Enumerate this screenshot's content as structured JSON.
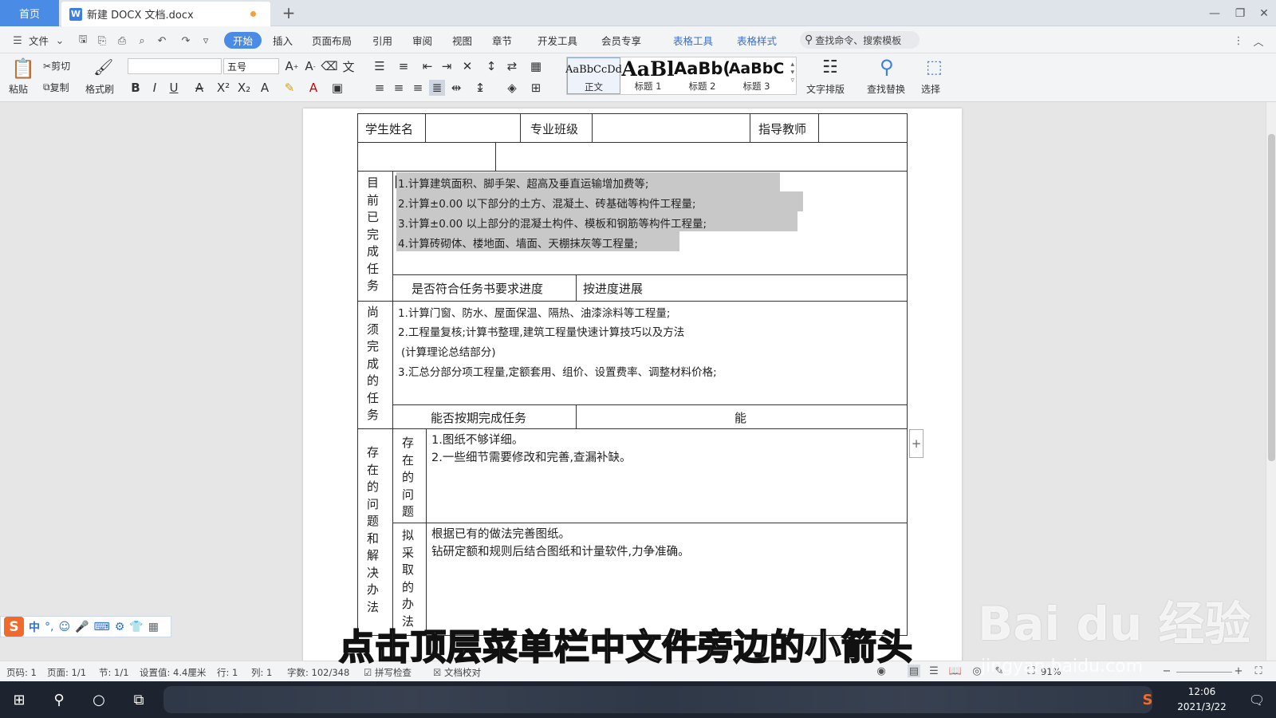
{
  "tabs": {
    "home": "首页",
    "doc_title": "新建 DOCX 文档.docx",
    "add": "+"
  },
  "menu": {
    "file": "文件",
    "items": [
      "开始",
      "插入",
      "页面布局",
      "引用",
      "审阅",
      "视图",
      "章节",
      "开发工具",
      "会员专享",
      "表格工具",
      "表格样式"
    ],
    "search_placeholder": "查找命令、搜索模板"
  },
  "ribbon": {
    "paste": "粘贴",
    "cut": "剪切",
    "copy": "复制",
    "format_painter": "格式刷",
    "font_name": "",
    "font_size": "五号",
    "styles": [
      {
        "preview": "AaBbCcDd",
        "name": "正文"
      },
      {
        "preview": "AaBl",
        "name": "标题 1"
      },
      {
        "preview": "AaBb(",
        "name": "标题 2"
      },
      {
        "preview": "AaBbC",
        "name": "标题 3"
      }
    ],
    "text_layout": "文字排版",
    "find_replace": "查找替换",
    "select": "选择"
  },
  "document": {
    "row1": {
      "student_name": "学生姓名",
      "major_class": "专业班级",
      "advisor": "指导教师"
    },
    "completed": {
      "label": [
        "目",
        "前",
        "已",
        "完",
        "成",
        "任",
        "务"
      ],
      "items": [
        "1.计算建筑面积、脚手架、超高及垂直运输增加费等;",
        "2.计算±0.00 以下部分的土方、混凝土、砖基础等构件工程量;",
        "3.计算±0.00 以上部分的混凝土构件、模板和钢筋等构件工程量;",
        "4.计算砖砌体、楼地面、墙面、天棚抹灰等工程量;"
      ],
      "progress_q": "是否符合任务书要求进度",
      "progress_a": "按进度进展"
    },
    "remaining": {
      "label": [
        "尚",
        "须",
        "完",
        "成",
        "的",
        "任",
        "务"
      ],
      "items": [
        "1.计算门窗、防水、屋面保温、隔热、油漆涂料等工程量;",
        "2.工程量复核;计算书整理,建筑工程量快速计算技巧以及方法",
        "(计算理论总结部分)",
        "3.汇总分部分项工程量,定额套用、组价、设置费率、调整材料价格;"
      ],
      "ontime_q": "能否按期完成任务",
      "ontime_a": "能"
    },
    "problems": {
      "label": [
        "存",
        "在",
        "的",
        "问",
        "题",
        "和",
        "解",
        "决",
        "办",
        "法"
      ],
      "sub1_label": [
        "存",
        "在",
        "的",
        "问",
        "题"
      ],
      "sub1_items": [
        "1.图纸不够详细。",
        "2.一些细节需要修改和完善,查漏补缺。"
      ],
      "sub2_label": [
        "拟",
        "采",
        "取",
        "的",
        "办",
        "法"
      ],
      "sub2_items": [
        "根据已有的做法完善图纸。",
        "钻研定额和规则后结合图纸和计量软件,力争准确。"
      ]
    }
  },
  "ime": {
    "zh": "中"
  },
  "status": {
    "page_no": "页码: 1",
    "page": "页面: 1/1",
    "section": "节: 1/1",
    "setting": "设置值: 4.4厘米",
    "row": "行: 1",
    "col": "列: 1",
    "word_count": "字数: 102/348",
    "spell": "拼写检查",
    "proof": "文档校对",
    "zoom": "91%"
  },
  "taskbar": {
    "time": "12:06",
    "date": "2021/3/22"
  },
  "caption": "点击顶层菜单栏中文件旁边的小箭头",
  "watermark": {
    "brand": "Bai du 经验",
    "url": "jingyan.baidu.com"
  },
  "colors": {
    "accent": "#4a8be6",
    "highlight": "#c8c8c8",
    "taskbar": "#1d2430"
  }
}
